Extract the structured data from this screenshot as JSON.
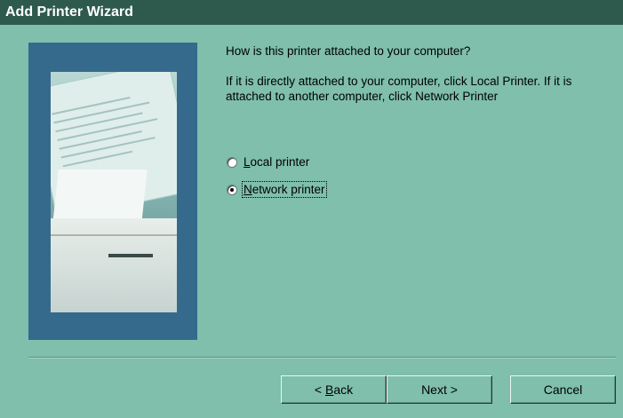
{
  "window": {
    "title": "Add Printer Wizard"
  },
  "content": {
    "question": "How is this printer attached to your computer?",
    "description": "If it is directly attached to your computer, click Local Printer. If it is attached to another computer, click Network Printer",
    "options": [
      {
        "mnemonic": "L",
        "rest": "ocal printer",
        "selected": false
      },
      {
        "mnemonic": "N",
        "rest": "etwork printer",
        "selected": true
      }
    ]
  },
  "buttons": {
    "back_arrow": "<",
    "back_mnemonic": "B",
    "back_rest": "ack",
    "next_label": "Next",
    "next_arrow": ">",
    "cancel_label": "Cancel"
  },
  "colors": {
    "background": "#7fbfac",
    "titlebar": "#2e5a4e",
    "side_panel": "#356a8c"
  },
  "icons": {
    "side_image": "printer-illustration"
  }
}
